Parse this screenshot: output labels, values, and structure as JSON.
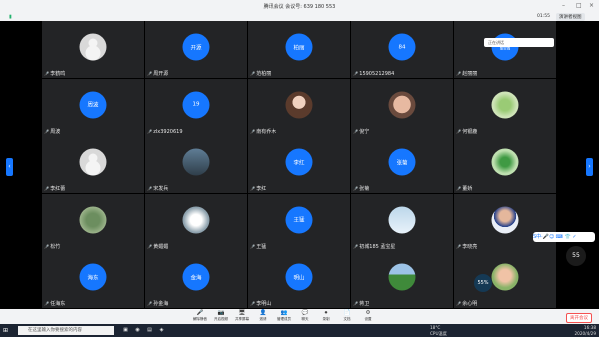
{
  "titlebar": {
    "title": "腾讯会议 会议号: 639 180 553",
    "min": "–",
    "max": "□",
    "close": "×"
  },
  "toolbar2": {
    "signal": "信号",
    "duration": "01:55",
    "view_label": "演讲者视图"
  },
  "nav": {
    "left": "‹",
    "right": "›"
  },
  "status_badge": "正在讲话",
  "tiles": [
    {
      "name": "李鹤鸣",
      "avatar": "grey",
      "avatar_text": ""
    },
    {
      "name": "周开源",
      "avatar": "blue",
      "avatar_text": "开源"
    },
    {
      "name": "范柏丽",
      "avatar": "blue",
      "avatar_text": "柏丽"
    },
    {
      "name": "15905212984",
      "avatar": "blue",
      "avatar_text": "84"
    },
    {
      "name": "赵丽丽",
      "avatar": "blue",
      "avatar_text": "丽丽"
    },
    {
      "name": "周波",
      "avatar": "blue",
      "avatar_text": "周波"
    },
    {
      "name": "zlx3920619",
      "avatar": "blue",
      "avatar_text": "19"
    },
    {
      "name": "南有乔木",
      "avatar": "ph-face1",
      "avatar_text": ""
    },
    {
      "name": "倪宁",
      "avatar": "ph-baby",
      "avatar_text": ""
    },
    {
      "name": "何银鹿",
      "avatar": "ph-leaf",
      "avatar_text": ""
    },
    {
      "name": "李红蕾",
      "avatar": "grey",
      "avatar_text": ""
    },
    {
      "name": "宋发兵",
      "avatar": "ph-sky",
      "avatar_text": ""
    },
    {
      "name": "李红",
      "avatar": "blue",
      "avatar_text": "李红"
    },
    {
      "name": "张菊",
      "avatar": "blue",
      "avatar_text": "张菊"
    },
    {
      "name": "董娇",
      "avatar": "ph-plant",
      "avatar_text": ""
    },
    {
      "name": "松竹",
      "avatar": "ph-tree",
      "avatar_text": ""
    },
    {
      "name": "黄媚媚",
      "avatar": "ph-bird",
      "avatar_text": ""
    },
    {
      "name": "王猛",
      "avatar": "blue",
      "avatar_text": "王猛"
    },
    {
      "name": "初城185 孟宝星",
      "avatar": "ph-plane",
      "avatar_text": ""
    },
    {
      "name": "李晓亮",
      "avatar": "ph-man",
      "avatar_text": ""
    },
    {
      "name": "任海东",
      "avatar": "blue",
      "avatar_text": "海东"
    },
    {
      "name": "孙金海",
      "avatar": "blue",
      "avatar_text": "金海"
    },
    {
      "name": "李明山",
      "avatar": "blue",
      "avatar_text": "明山"
    },
    {
      "name": "蒋卫",
      "avatar": "ph-outdoor",
      "avatar_text": ""
    },
    {
      "name": "余心明",
      "avatar": "ph-child",
      "avatar_text": ""
    }
  ],
  "floating": {
    "speed_right": "55",
    "speed_left": "55%"
  },
  "net_badge": "S中·🎤☺ ⌨ 👕 ✓",
  "meeting_bar": {
    "buttons": [
      {
        "label": "解除静音",
        "icon": "🎤"
      },
      {
        "label": "开启视频",
        "icon": "📷"
      },
      {
        "label": "共享屏幕",
        "icon": "🖥"
      },
      {
        "label": "邀请",
        "icon": "👤"
      },
      {
        "label": "管理成员",
        "icon": "👥"
      },
      {
        "label": "聊天",
        "icon": "💬"
      },
      {
        "label": "录制",
        "icon": "⏺"
      },
      {
        "label": "文档",
        "icon": "📄"
      },
      {
        "label": "设置",
        "icon": "⚙"
      }
    ],
    "leave_label": "离开会议"
  },
  "taskbar": {
    "start": "⊞",
    "search_placeholder": "在这里输入你要搜索的内容",
    "weather_temp": "18°C",
    "weather_text": "CPU温度",
    "time": "16:38",
    "date": "2020/4/29"
  }
}
